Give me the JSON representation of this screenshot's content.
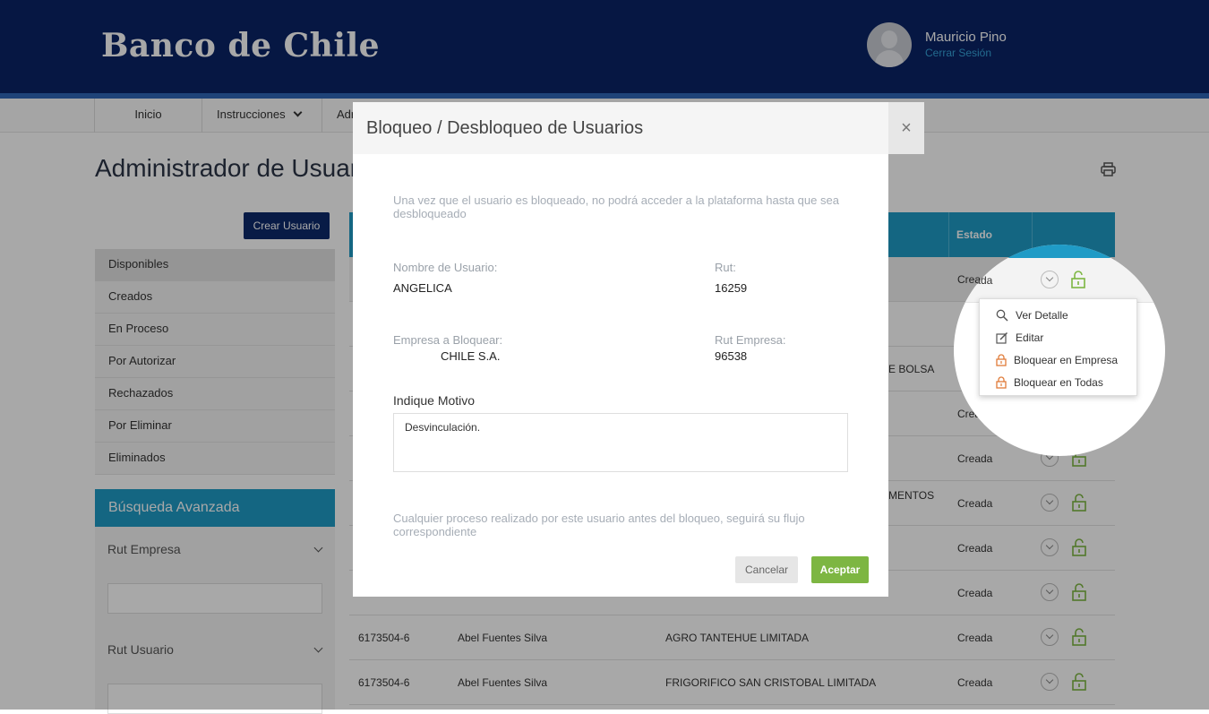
{
  "header": {
    "brand": "Banco de Chile",
    "user_name": "Mauricio Pino",
    "logout": "Cerrar Sesión"
  },
  "nav": [
    {
      "label": "Inicio"
    },
    {
      "label": "Instrucciones"
    },
    {
      "label": "Adr"
    }
  ],
  "page": {
    "title": "Administrador de Usuarios",
    "create_button": "Crear Usuario"
  },
  "sidebar": {
    "items": [
      "Disponibles",
      "Creados",
      "En Proceso",
      "Por Autorizar",
      "Rechazados",
      "Por Eliminar",
      "Eliminados"
    ],
    "advanced_title": "Búsqueda Avanzada",
    "rut_empresa": "Rut Empresa",
    "rut_usuario": "Rut Usuario"
  },
  "table": {
    "header_estado": "Estado",
    "rows": [
      {
        "rut": "",
        "nombre": "",
        "empresa": "",
        "estado": "Creada"
      },
      {
        "rut": "",
        "nombre": "",
        "empresa": "",
        "estado": "Crea"
      },
      {
        "rut": "",
        "nombre": "",
        "empresa": "E BOLSA",
        "estado": "Crea"
      },
      {
        "rut": "",
        "nombre": "",
        "empresa": "",
        "estado": "Creada"
      },
      {
        "rut": "",
        "nombre": "",
        "empresa": "",
        "estado": "Creada"
      },
      {
        "rut": "",
        "nombre": "",
        "empresa": "MENTOS",
        "estado": "Creada"
      },
      {
        "rut": "",
        "nombre": "",
        "empresa": "",
        "estado": "Creada"
      },
      {
        "rut": "",
        "nombre": "",
        "empresa": "",
        "estado": "Creada"
      },
      {
        "rut": "6173504-6",
        "nombre": "Abel Fuentes Silva",
        "empresa": "AGRO TANTEHUE LIMITADA",
        "estado": "Creada"
      },
      {
        "rut": "6173504-6",
        "nombre": "Abel Fuentes Silva",
        "empresa": "FRIGORIFICO SAN CRISTOBAL LIMITADA",
        "estado": "Creada"
      }
    ]
  },
  "modal": {
    "title": "Bloqueo / Desbloqueo de Usuarios",
    "close": "×",
    "intro": "Una vez que el usuario es bloqueado, no podrá acceder a la plataforma hasta que sea desbloqueado",
    "nombre_label": "Nombre de Usuario:",
    "nombre_value": "ANGELICA",
    "rut_label": "Rut:",
    "rut_value": "16259",
    "empresa_label": "Empresa a Bloquear:",
    "empresa_value": "CHILE S.A.",
    "rut_empresa_label": "Rut Empresa:",
    "rut_empresa_value": "96538",
    "motivo_label": "Indique Motivo",
    "motivo_value": "Desvinculación.",
    "footer_note": "Cualquier proceso realizado por este usuario antes del bloqueo, seguirá su flujo correspondiente",
    "cancel": "Cancelar",
    "accept": "Aceptar"
  },
  "context_menu": {
    "row_estado": "Creada",
    "items": [
      "Ver Detalle",
      "Editar",
      "Bloquear en Empresa",
      "Bloquear en Todas"
    ]
  },
  "colors": {
    "header": "#0a2466",
    "accent": "#1f9bc6",
    "accept": "#7db642",
    "lock_green": "#7db642",
    "lock_orange": "#e07b39"
  }
}
